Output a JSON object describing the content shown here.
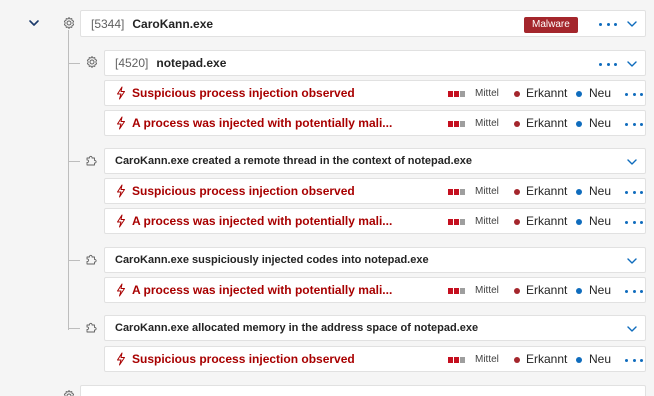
{
  "root": {
    "pid": "[5344]",
    "name": "CaroKann.exe",
    "badge": "Malware",
    "icon": "gear-icon"
  },
  "child": {
    "pid": "[4520]",
    "name": "notepad.exe",
    "icon": "gear-icon"
  },
  "severity_label": "Mittel",
  "status_detected": "Erkannt",
  "status_new": "Neu",
  "colors": {
    "alert_red": "#a80000",
    "badge": "#a4262c",
    "severity_filled": "#c50f1f",
    "severity_empty": "#9e9e9e",
    "detected_dot": "#a4262c",
    "new_dot": "#0f6cbd",
    "accent": "#0f6cbd"
  },
  "alerts": [
    {
      "title": "Suspicious process injection observed"
    },
    {
      "title": "A process was injected with potentially mali..."
    },
    {
      "title": "Suspicious process injection observed"
    },
    {
      "title": "A process was injected with potentially mali..."
    },
    {
      "title": "A process was injected with potentially mali..."
    },
    {
      "title": "Suspicious process injection observed"
    }
  ],
  "events": [
    {
      "title": "CaroKann.exe created a remote thread in the context of notepad.exe",
      "icon": "puzzle-icon"
    },
    {
      "title": "CaroKann.exe suspiciously injected codes into notepad.exe",
      "icon": "puzzle-icon"
    },
    {
      "title": "CaroKann.exe allocated memory in the address space of notepad.exe",
      "icon": "puzzle-icon"
    }
  ]
}
